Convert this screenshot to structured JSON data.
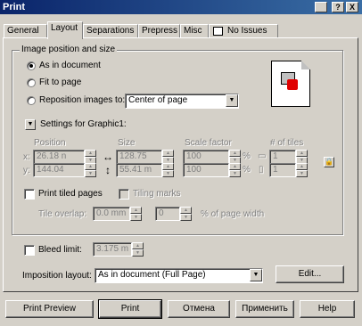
{
  "window": {
    "title": "Print",
    "buttons": [
      "?",
      "X"
    ]
  },
  "tabs": [
    {
      "label": "General"
    },
    {
      "label": "Layout"
    },
    {
      "label": "Separations"
    },
    {
      "label": "Prepress"
    },
    {
      "label": "Misc"
    },
    {
      "label": "No Issues"
    }
  ],
  "active_tab": "Layout",
  "image_position": {
    "group_title": "Image position and size",
    "options": [
      {
        "label": "As in document",
        "checked": true
      },
      {
        "label": "Fit to page",
        "checked": false
      },
      {
        "label": "Reposition images to:",
        "checked": false
      }
    ],
    "reposition_value": "Center of page"
  },
  "settings": {
    "label": "Settings for Graphic1:",
    "col_position": "Position",
    "col_size": "Size",
    "col_scale": "Scale factor",
    "col_tiles": "# of tiles",
    "x_label": "x:",
    "y_label": "y:",
    "pos_x": "26.18 n",
    "pos_y": "144.04",
    "size_w": "128.75",
    "size_h": "55.41 m",
    "scale_x": "100",
    "scale_y": "100",
    "pct": "%",
    "tiles_x": "1",
    "tiles_y": "1"
  },
  "tiling": {
    "print_tiled_label": "Print tiled pages",
    "tiling_marks_label": "Tiling marks",
    "tile_overlap_label": "Tile overlap:",
    "overlap_value": "0.0 mm",
    "overlap_pct": "0",
    "pct_label": "% of page width"
  },
  "bleed": {
    "label": "Bleed limit:",
    "value": "3.175 m"
  },
  "imposition": {
    "label": "Imposition layout:",
    "value": "As in document (Full Page)",
    "edit_label": "Edit..."
  },
  "footer": {
    "buttons": [
      "Print Preview",
      "Print",
      "Отмена",
      "Применить",
      "Help"
    ]
  }
}
